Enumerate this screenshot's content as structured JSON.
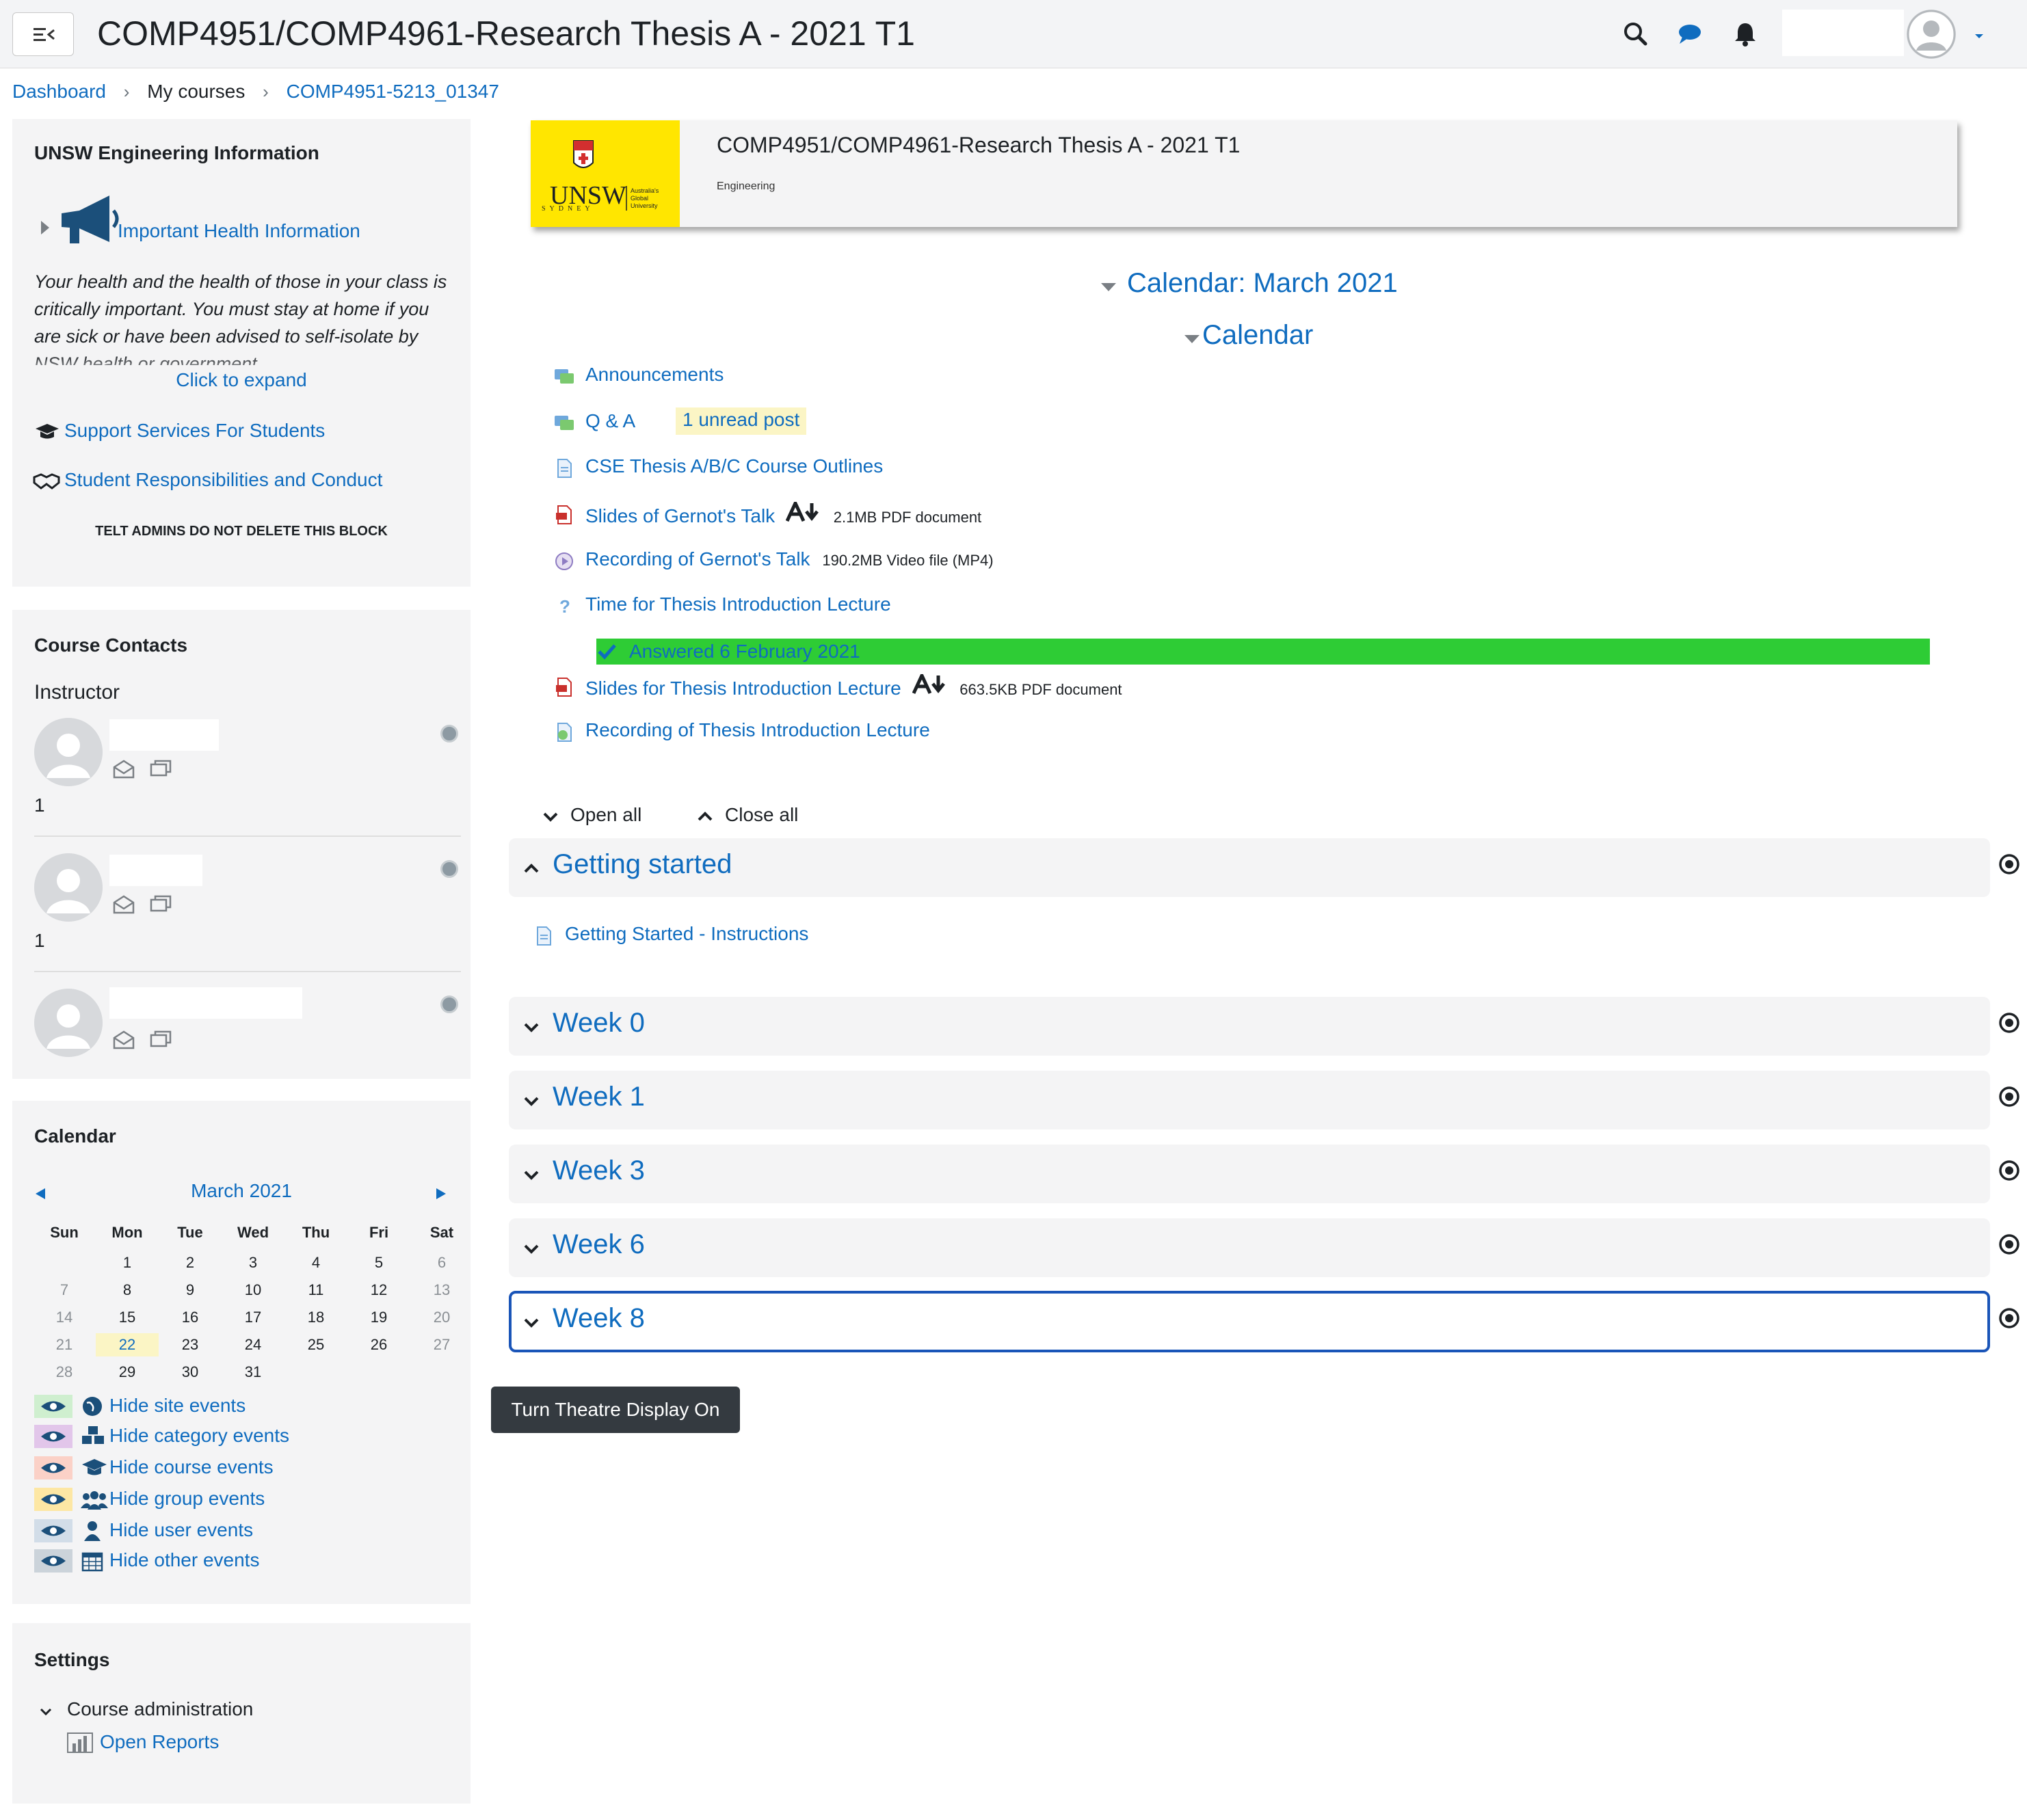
{
  "navbar": {
    "title": "COMP4951/COMP4961-Research Thesis A - 2021 T1",
    "icons": [
      "menu-collapse-icon",
      "search-icon",
      "chat-icon",
      "bell-icon",
      "user-avatar",
      "caret-down-icon"
    ]
  },
  "breadcrumb": {
    "items": [
      "Dashboard",
      "My courses",
      "COMP4951-5213_01347"
    ]
  },
  "eng_info": {
    "title": "UNSW Engineering Information",
    "health_link": "Important Health Information",
    "health_text": "Your health and the health of those in your class is critically important. You must stay at home if you are sick or have been advised to self-isolate by NSW health or government",
    "expand": "Click to expand",
    "support_link": "Support Services For Students",
    "conduct_link": "Student Responsibilities and Conduct",
    "admin_note": "TELT ADMINS DO NOT DELETE THIS BLOCK"
  },
  "contacts": {
    "title": "Course Contacts",
    "role": "Instructor",
    "counts": [
      "1",
      "1"
    ]
  },
  "calendar_block": {
    "title": "Calendar",
    "month": "March 2021",
    "weekdays": [
      "Sun",
      "Mon",
      "Tue",
      "Wed",
      "Thu",
      "Fri",
      "Sat"
    ],
    "weeks": [
      [
        "",
        "1",
        "2",
        "3",
        "4",
        "5",
        "6"
      ],
      [
        "7",
        "8",
        "9",
        "10",
        "11",
        "12",
        "13"
      ],
      [
        "14",
        "15",
        "16",
        "17",
        "18",
        "19",
        "20"
      ],
      [
        "21",
        "22",
        "23",
        "24",
        "25",
        "26",
        "27"
      ],
      [
        "28",
        "29",
        "30",
        "31",
        "",
        "",
        ""
      ]
    ],
    "today": "22",
    "events": [
      {
        "label": "Hide site events",
        "color": "#cfefcf",
        "icon": "globe-icon"
      },
      {
        "label": "Hide category events",
        "color": "#e2c6ea",
        "icon": "cubes-icon"
      },
      {
        "label": "Hide course events",
        "color": "#fbd1c7",
        "icon": "graduation-cap-icon"
      },
      {
        "label": "Hide group events",
        "color": "#fde7a4",
        "icon": "group-icon"
      },
      {
        "label": "Hide user events",
        "color": "#d2dde8",
        "icon": "user-icon"
      },
      {
        "label": "Hide other events",
        "color": "#cbd3da",
        "icon": "calendar-icon"
      }
    ]
  },
  "settings": {
    "title": "Settings",
    "course_admin": "Course administration",
    "reports": "Open Reports"
  },
  "course_header": {
    "title": "COMP4951/COMP4961-Research Thesis A - 2021 T1",
    "category": "Engineering",
    "logo_text": "UNSW"
  },
  "top_section": {
    "calendar_title": "Calendar: March 2021",
    "calendar_sub": "Calendar",
    "activities": [
      {
        "label": "Announcements",
        "meta": "",
        "icon": "forum-icon"
      },
      {
        "label": "Q & A",
        "meta": "",
        "icon": "forum-icon"
      },
      {
        "label": "CSE Thesis A/B/C Course Outlines",
        "meta": "",
        "icon": "page-icon"
      },
      {
        "label": "Slides of Gernot's Talk",
        "meta": "2.1MB PDF document",
        "icon": "pdf-icon"
      },
      {
        "label": "Recording of Gernot's Talk",
        "meta": "190.2MB Video file (MP4)",
        "icon": "video-icon"
      },
      {
        "label": "Time for Thesis Introduction Lecture",
        "meta": "",
        "icon": "question-icon"
      },
      {
        "label": "Slides for Thesis Introduction Lecture",
        "meta": "663.5KB PDF document",
        "icon": "pdf-icon"
      },
      {
        "label": "Recording of Thesis Introduction Lecture",
        "meta": "",
        "icon": "url-icon"
      }
    ],
    "unread": "1 unread post",
    "answered": "Answered 6 February 2021"
  },
  "controls": {
    "open_all": "Open all",
    "close_all": "Close all"
  },
  "sections": [
    {
      "name": "Getting started",
      "expanded": true
    },
    {
      "name": "Week 0",
      "expanded": false
    },
    {
      "name": "Week 1",
      "expanded": false
    },
    {
      "name": "Week 3",
      "expanded": false
    },
    {
      "name": "Week 6",
      "expanded": false
    },
    {
      "name": "Week 8",
      "expanded": false
    }
  ],
  "getting_started_item": "Getting Started - Instructions",
  "theatre_button": "Turn Theatre Display On"
}
